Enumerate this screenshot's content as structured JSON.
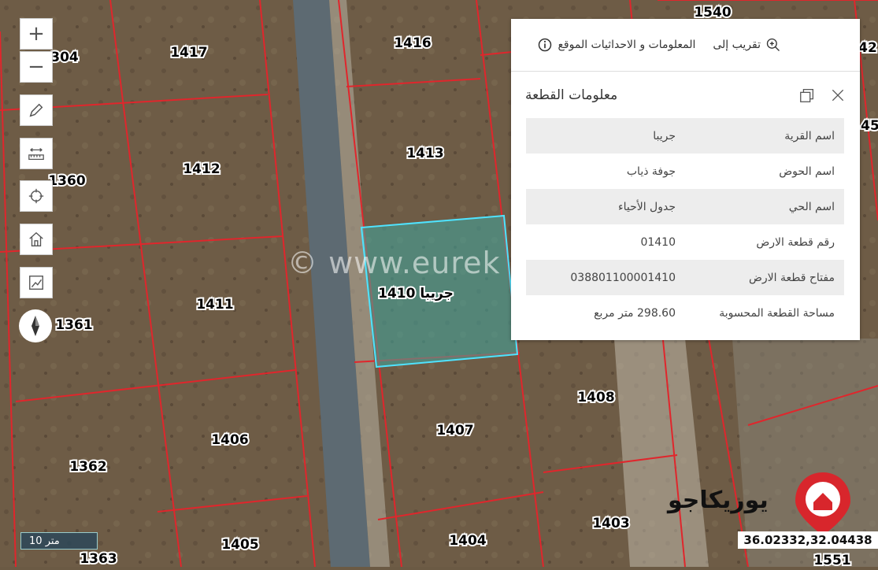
{
  "map": {
    "parcel_labels": [
      "1416",
      "1417",
      "1540",
      "1413",
      "1412",
      "1360",
      "1411",
      "1361",
      "1408",
      "1407",
      "1406",
      "1362",
      "1403",
      "1404",
      "1405",
      "1363",
      "1551",
      "42",
      "45"
    ],
    "edge_labels": [
      "304",
      "1410"
    ],
    "selected_parcel_label": "جريبا 1410",
    "watermark": "© www.eurek",
    "brand_text": "يوريكاجو",
    "colors": {
      "parcel_line": "#e0262c",
      "selection_fill": "#3fa7a0",
      "selection_stroke": "#4fe3ff",
      "bg": "#6b5a44"
    }
  },
  "controls": {
    "zoom_in": "+",
    "zoom_out": "−",
    "icons": [
      "pencil-icon",
      "ruler-icon",
      "crosshair-icon",
      "home-icon",
      "layers-icon",
      "compass-icon"
    ]
  },
  "popup": {
    "action_zoom": "تقريب إلى",
    "action_info": "المعلومات و الاحداثيات الموقع",
    "title": "معلومات القطعة",
    "rows": [
      {
        "key": "اسم القرية",
        "value": "جريبا"
      },
      {
        "key": "اسم الحوض",
        "value": "جوفة ذياب"
      },
      {
        "key": "اسم الحي",
        "value": "جدول الأحياء"
      },
      {
        "key": "رقم قطعة الارض",
        "value": "01410"
      },
      {
        "key": "مفتاح قطعة الارض",
        "value": "038801100001410"
      },
      {
        "key": "مساحة القطعة المحسوبة",
        "value": "298.60 متر مربع"
      }
    ]
  },
  "scale": {
    "label": "10 متر"
  },
  "coordinates": {
    "text": "36.02332,32.04438"
  }
}
